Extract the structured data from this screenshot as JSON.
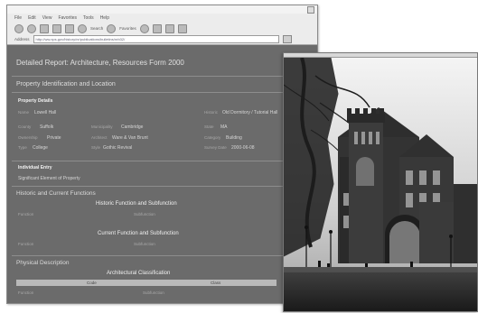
{
  "browser": {
    "menu": [
      "File",
      "Edit",
      "View",
      "Favorites",
      "Tools",
      "Help"
    ],
    "toolbar": {
      "search_label": "Search",
      "favorites_label": "Favorites"
    },
    "address": {
      "label": "Address",
      "url": "http://ww.nps.gov/history/nr/publications/bulletins/nrb32/"
    }
  },
  "page": {
    "title": "Detailed Report: Architecture, Resources Form 2000",
    "section1": "Property Identification and Location",
    "subsection1": "Property Details",
    "rows": [
      {
        "a_label": "Name",
        "a_value": "Lowell Hall",
        "b_label": "Historic",
        "b_value": "Old Dormitory / Tutorial Hall"
      },
      {
        "a_label": "County",
        "a_value": "Suffolk",
        "b_label": "Municipality",
        "b_value": "Cambridge",
        "c_label": "State",
        "c_value": "MA"
      },
      {
        "a_label": "Ownership",
        "a_value": "Private",
        "b_label": "Architect",
        "b_value": "Ware & Van Brunt",
        "c_label": "Category",
        "c_value": "Building"
      },
      {
        "a_label": "Type",
        "a_value": "College",
        "b_label": "Style",
        "b_value": "Gothic Revival",
        "c_label": "Survey Date",
        "c_value": "2000-06-08"
      }
    ],
    "section2": "Individual Entry",
    "section2_value": "Significant Element of Property",
    "section3": "Historic and Current Functions",
    "historic_heading": "Historic Function and Subfunction",
    "current_heading": "Current Function and Subfunction",
    "function_label_a": "Function",
    "function_label_b": "Subfunction",
    "section4": "Physical Description",
    "arch_heading": "Architectural Classification",
    "bar_left": "Code",
    "bar_right": "Class"
  }
}
